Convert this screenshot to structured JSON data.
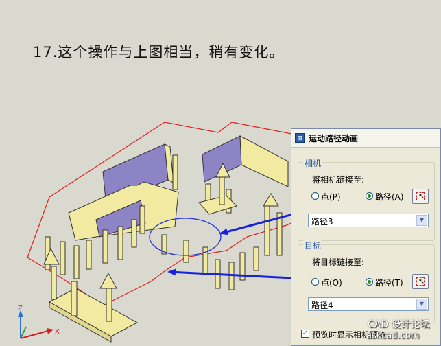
{
  "caption": "17.这个操作与上图相当，稍有变化。",
  "dialog": {
    "title": "运动路径动画",
    "camera": {
      "group_label": "相机",
      "link_label": "将相机链接至:",
      "point_option": "点(P)",
      "path_option": "路径(A)",
      "selected": "path",
      "dropdown_value": "路径3"
    },
    "target": {
      "group_label": "目标",
      "link_label": "将目标链接至:",
      "point_option": "点(O)",
      "path_option": "路径(T)",
      "selected": "path",
      "dropdown_value": "路径4"
    },
    "preview_checkbox": {
      "label": "预览时显示相机预览",
      "checked": true
    }
  },
  "watermark": {
    "text": "CAD 设计论坛",
    "url": "askcad.com"
  },
  "colors": {
    "background": "#d9d9cf",
    "walls_purple": "#8c84c4",
    "walls_tan": "#f1eaa0",
    "outline_red": "#e02020",
    "path_blue": "#2030e0",
    "arrow_blue": "#1a22d8"
  },
  "icons": [
    "app-icon",
    "pick-point-icon",
    "dropdown-arrow-icon",
    "ucs-axis-icon"
  ]
}
